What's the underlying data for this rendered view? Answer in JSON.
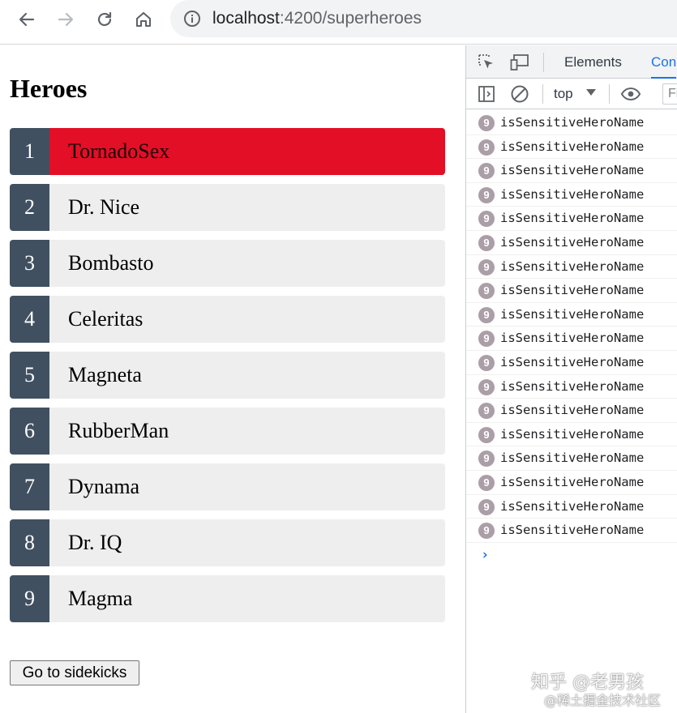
{
  "browser": {
    "url_host": "localhost",
    "url_path": ":4200/superheroes",
    "icons": [
      "back-arrow-icon",
      "forward-arrow-icon",
      "reload-icon",
      "home-icon",
      "site-info-icon"
    ]
  },
  "app": {
    "title": "Heroes",
    "heroes": [
      {
        "id": "1",
        "name": "TornadoSex",
        "flagged": true
      },
      {
        "id": "2",
        "name": "Dr. Nice",
        "flagged": false
      },
      {
        "id": "3",
        "name": "Bombasto",
        "flagged": false
      },
      {
        "id": "4",
        "name": "Celeritas",
        "flagged": false
      },
      {
        "id": "5",
        "name": "Magneta",
        "flagged": false
      },
      {
        "id": "6",
        "name": "RubberMan",
        "flagged": false
      },
      {
        "id": "7",
        "name": "Dynama",
        "flagged": false
      },
      {
        "id": "8",
        "name": "Dr. IQ",
        "flagged": false
      },
      {
        "id": "9",
        "name": "Magma",
        "flagged": false
      }
    ],
    "sidekicks_button": "Go to sidekicks",
    "colors": {
      "badge": "#405061",
      "item": "#eeeeee",
      "flagged": "#e30f26"
    }
  },
  "devtools": {
    "tabs": [
      {
        "label": "Elements",
        "active": false
      },
      {
        "label": "Con",
        "active": true
      }
    ],
    "context": "top",
    "filter_placeholder": "Fi",
    "log_entries": [
      {
        "count": "9",
        "message": "isSensitiveHeroName"
      },
      {
        "count": "9",
        "message": "isSensitiveHeroName"
      },
      {
        "count": "9",
        "message": "isSensitiveHeroName"
      },
      {
        "count": "9",
        "message": "isSensitiveHeroName"
      },
      {
        "count": "9",
        "message": "isSensitiveHeroName"
      },
      {
        "count": "9",
        "message": "isSensitiveHeroName"
      },
      {
        "count": "9",
        "message": "isSensitiveHeroName"
      },
      {
        "count": "9",
        "message": "isSensitiveHeroName"
      },
      {
        "count": "9",
        "message": "isSensitiveHeroName"
      },
      {
        "count": "9",
        "message": "isSensitiveHeroName"
      },
      {
        "count": "9",
        "message": "isSensitiveHeroName"
      },
      {
        "count": "9",
        "message": "isSensitiveHeroName"
      },
      {
        "count": "9",
        "message": "isSensitiveHeroName"
      },
      {
        "count": "9",
        "message": "isSensitiveHeroName"
      },
      {
        "count": "9",
        "message": "isSensitiveHeroName"
      },
      {
        "count": "9",
        "message": "isSensitiveHeroName"
      },
      {
        "count": "9",
        "message": "isSensitiveHeroName"
      },
      {
        "count": "9",
        "message": "isSensitiveHeroName"
      }
    ],
    "prompt": "›"
  },
  "watermark": {
    "line1": "知乎 @老男孩",
    "line2": "@稀土掘金技术社区"
  }
}
